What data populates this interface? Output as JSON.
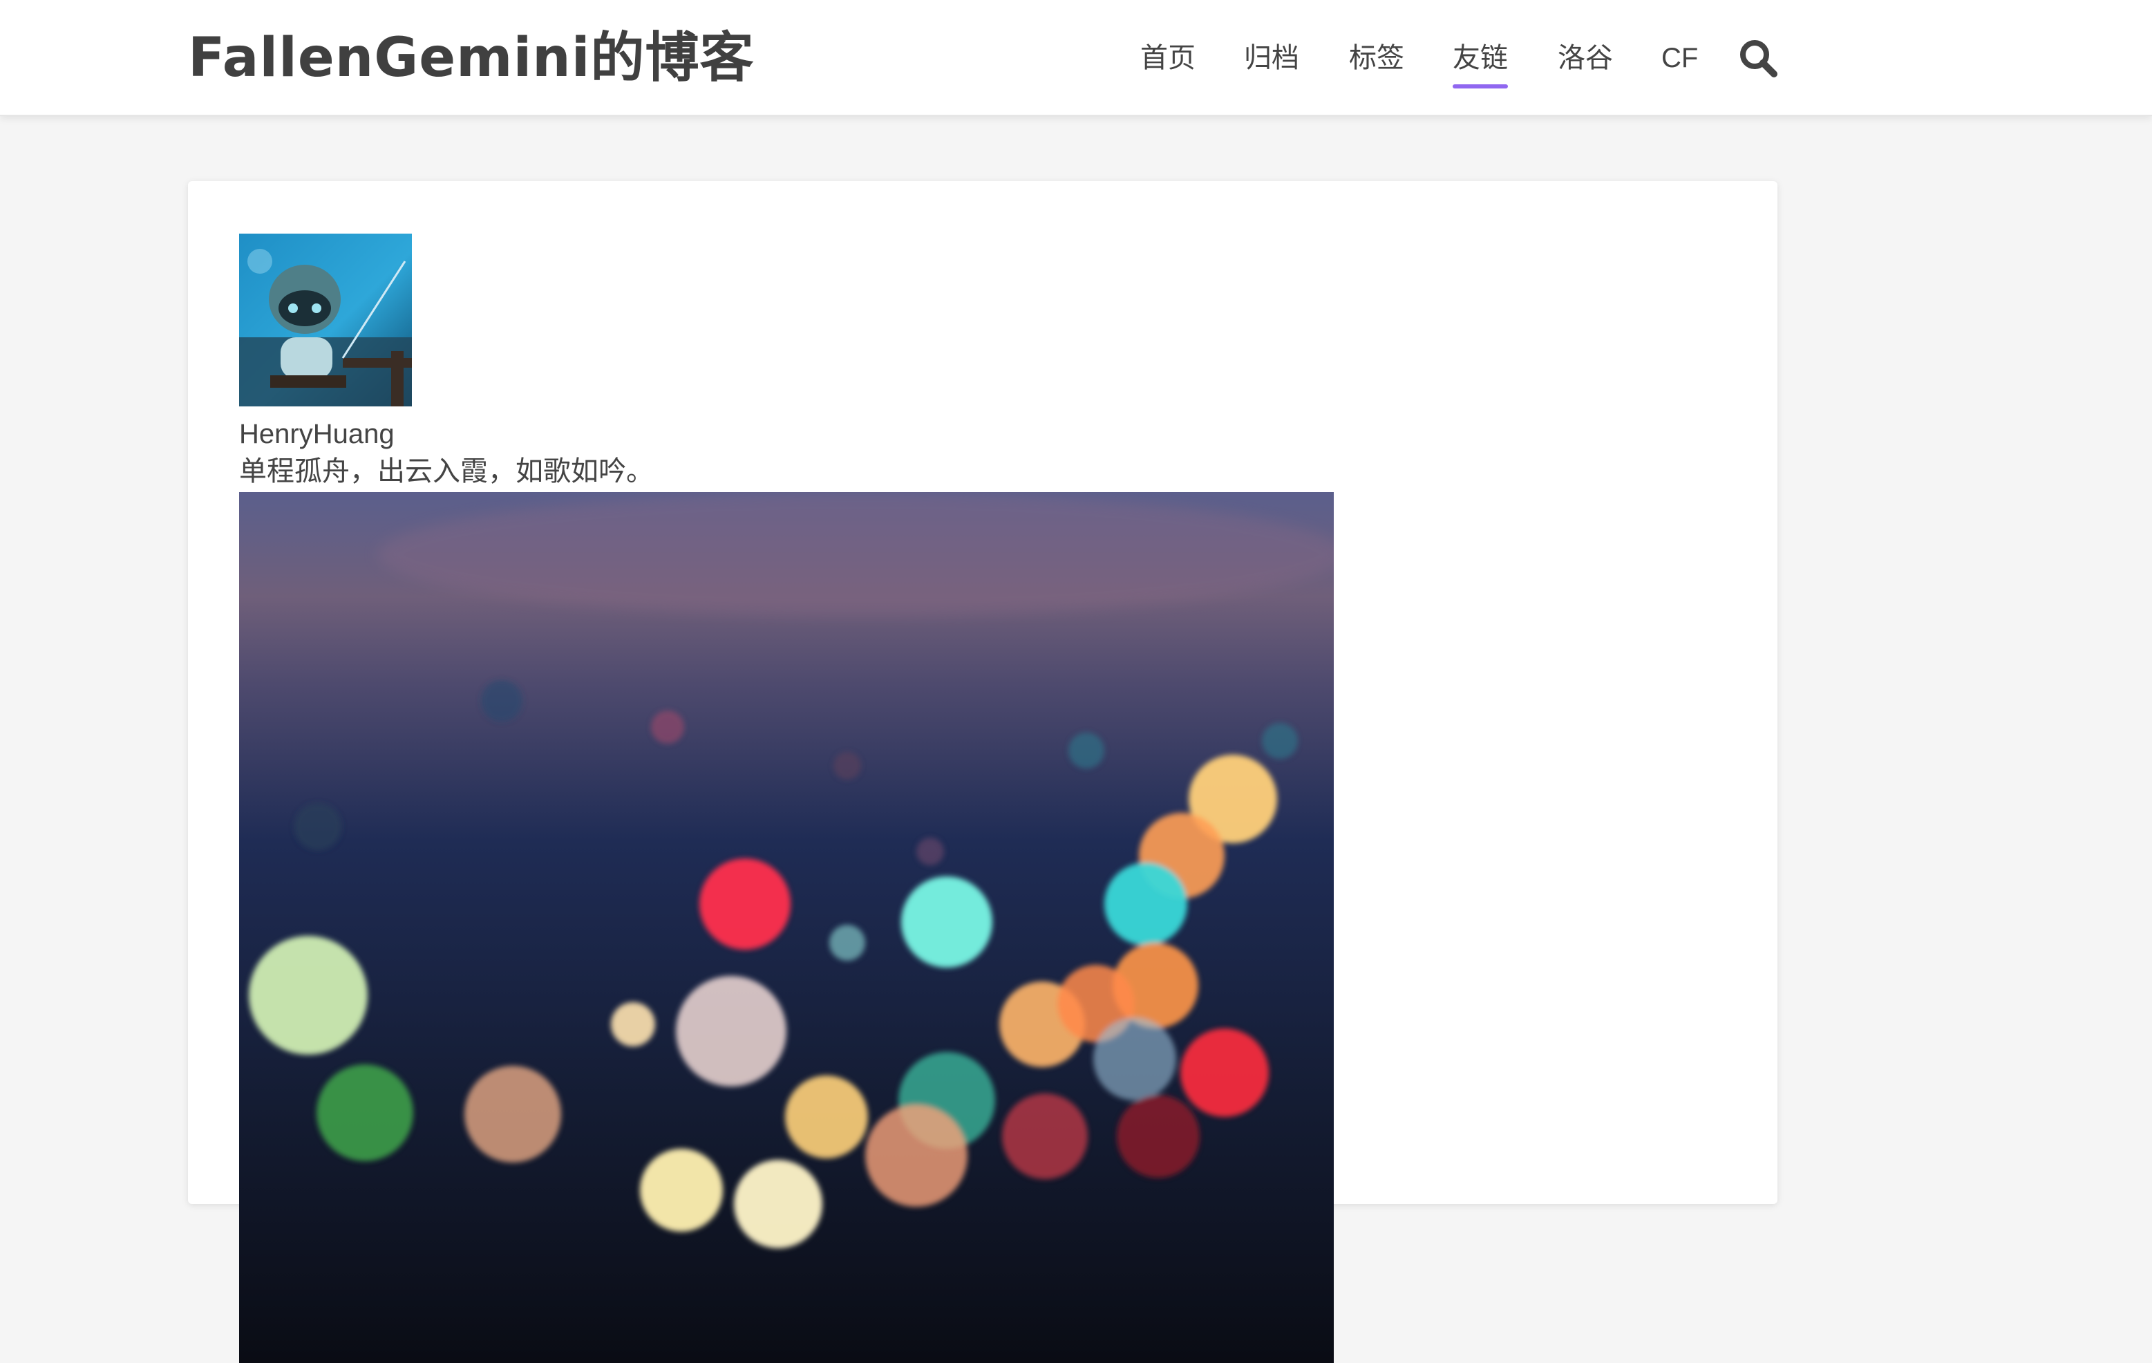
{
  "header": {
    "site_title": "FallenGemini的博客",
    "nav": [
      {
        "label": "首页",
        "active": false
      },
      {
        "label": "归档",
        "active": false
      },
      {
        "label": "标签",
        "active": false
      },
      {
        "label": "友链",
        "active": true
      },
      {
        "label": "洛谷",
        "active": false
      },
      {
        "label": "CF",
        "active": false
      }
    ],
    "search_icon": "search-icon",
    "accent_color": "#9067f0"
  },
  "friend_card": {
    "avatar_icon": "avatar",
    "name": "HenryHuang",
    "description": "单程孤舟，出云入霞，如歌如吟。",
    "cover_image": "bokeh-city-lights-photo"
  }
}
